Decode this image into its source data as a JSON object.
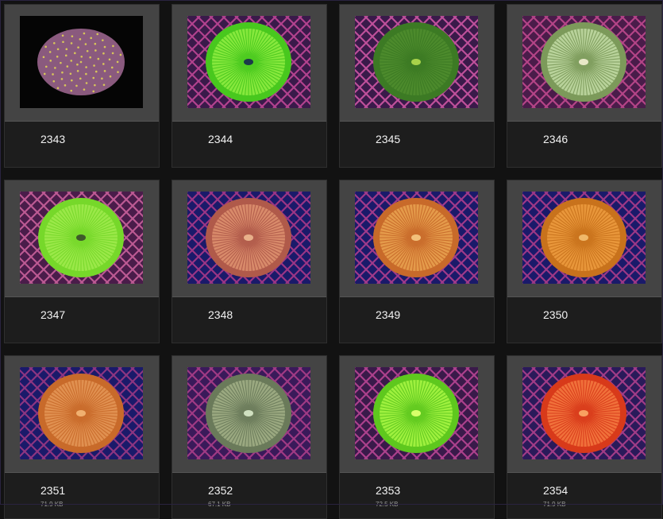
{
  "gallery": {
    "items": [
      {
        "id": "2343",
        "size": "",
        "bg": "#050505",
        "grid": false,
        "shape": "brain",
        "outer": "#8a5a7e",
        "inner": "#a76a8c",
        "accent": "#d8c65a"
      },
      {
        "id": "2344",
        "size": "",
        "bg": "#3a1a4a",
        "grid": true,
        "gridColor": "#c84a9a",
        "shape": "disk",
        "outer": "#48c81e",
        "inner": "#86e83c",
        "accent": "#1c3a4a"
      },
      {
        "id": "2345",
        "size": "",
        "bg": "#3a1a4a",
        "grid": true,
        "gridColor": "#d65aa8",
        "shape": "disk",
        "outer": "#3c7a24",
        "inner": "#4c8a2c",
        "accent": "#a8d24a"
      },
      {
        "id": "2346",
        "size": "",
        "bg": "#4a1c4a",
        "grid": true,
        "gridColor": "#c74c92",
        "shape": "disk",
        "outer": "#7c9a5a",
        "inner": "#b8d29a",
        "accent": "#e8e8c8"
      },
      {
        "id": "2347",
        "size": "",
        "bg": "#4a1c4a",
        "grid": true,
        "gridColor": "#d065a0",
        "shape": "disk",
        "outer": "#76d82a",
        "inner": "#9ae848",
        "accent": "#3e5a2a"
      },
      {
        "id": "2348",
        "size": "",
        "bg": "#1a1a6a",
        "grid": true,
        "gridColor": "#b23a8a",
        "shape": "disk",
        "outer": "#b05a4a",
        "inner": "#d88a6a",
        "accent": "#e8b08a"
      },
      {
        "id": "2349",
        "size": "",
        "bg": "#1a1a6a",
        "grid": true,
        "gridColor": "#b84090",
        "shape": "disk",
        "outer": "#c86a2a",
        "inner": "#e49a4a",
        "accent": "#f2c07a"
      },
      {
        "id": "2350",
        "size": "",
        "bg": "#1a1a6a",
        "grid": true,
        "gridColor": "#b43e8c",
        "shape": "disk",
        "outer": "#c8721c",
        "inner": "#e8963a",
        "accent": "#f0b86a"
      },
      {
        "id": "2351",
        "size": "71.9 KB",
        "bg": "#1a1a6a",
        "grid": true,
        "gridColor": "#a23a86",
        "shape": "disk",
        "outer": "#c86a2a",
        "inner": "#e09050",
        "accent": "#f0b070"
      },
      {
        "id": "2352",
        "size": "67.1 KB",
        "bg": "#3a1a5a",
        "grid": true,
        "gridColor": "#b2408c",
        "shape": "disk",
        "outer": "#6a7a5a",
        "inner": "#9aa880",
        "accent": "#d0e0c0"
      },
      {
        "id": "2353",
        "size": "72.5 KB",
        "bg": "#3a1a4a",
        "grid": true,
        "gridColor": "#c04898",
        "shape": "disk",
        "outer": "#5ec81e",
        "inner": "#9ef03e",
        "accent": "#d8ff6a"
      },
      {
        "id": "2354",
        "size": "71.9 KB",
        "bg": "#2a1a5a",
        "grid": true,
        "gridColor": "#b64290",
        "shape": "disk",
        "outer": "#d83a1a",
        "inner": "#f0703a",
        "accent": "#f8a060"
      }
    ]
  }
}
